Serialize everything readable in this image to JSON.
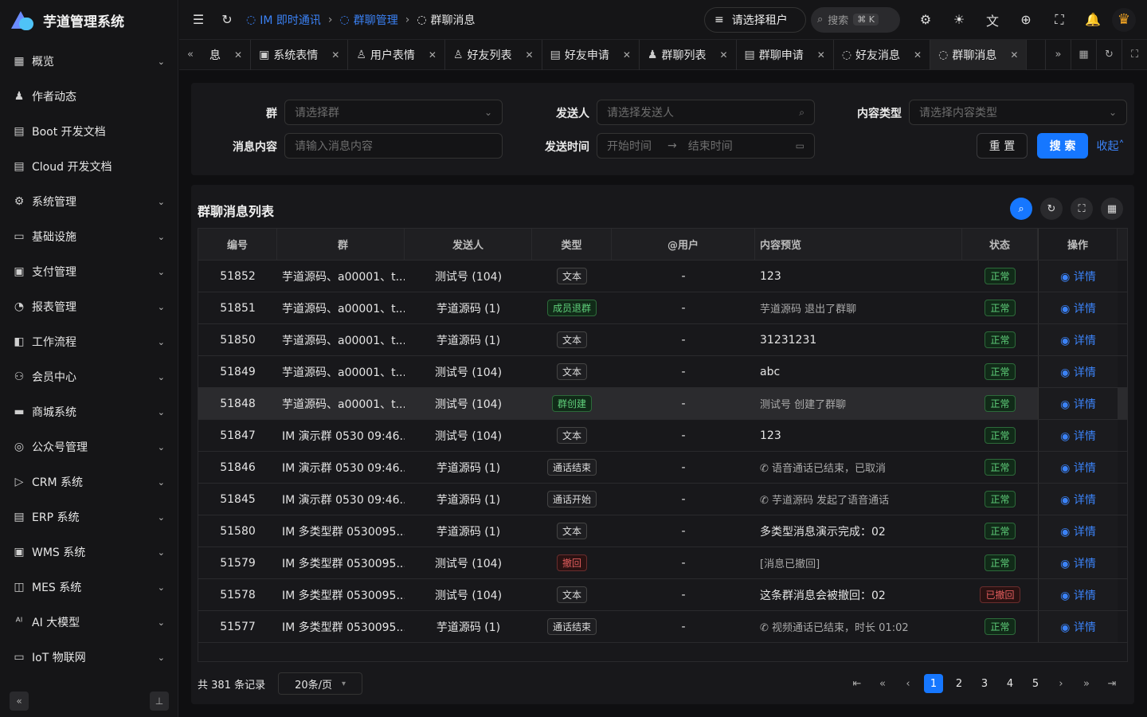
{
  "app": {
    "title": "芋道管理系统"
  },
  "sidebar": {
    "items": [
      {
        "label": "概览",
        "icon": "grid-icon",
        "chevron": true
      },
      {
        "label": "作者动态",
        "icon": "user-icon",
        "chevron": false
      },
      {
        "label": "Boot 开发文档",
        "icon": "doc-icon",
        "chevron": false
      },
      {
        "label": "Cloud 开发文档",
        "icon": "doc-icon",
        "chevron": false
      },
      {
        "label": "系统管理",
        "icon": "gear-icon",
        "chevron": true
      },
      {
        "label": "基础设施",
        "icon": "monitor-icon",
        "chevron": true
      },
      {
        "label": "支付管理",
        "icon": "pay-icon",
        "chevron": true
      },
      {
        "label": "报表管理",
        "icon": "chart-icon",
        "chevron": true
      },
      {
        "label": "工作流程",
        "icon": "flow-icon",
        "chevron": true
      },
      {
        "label": "会员中心",
        "icon": "members-icon",
        "chevron": true
      },
      {
        "label": "商城系统",
        "icon": "shop-icon",
        "chevron": true
      },
      {
        "label": "公众号管理",
        "icon": "compass-icon",
        "chevron": true
      },
      {
        "label": "CRM 系统",
        "icon": "crm-icon",
        "chevron": true
      },
      {
        "label": "ERP 系统",
        "icon": "erp-icon",
        "chevron": true
      },
      {
        "label": "WMS 系统",
        "icon": "box-icon",
        "chevron": true
      },
      {
        "label": "MES 系统",
        "icon": "chip-icon",
        "chevron": true
      },
      {
        "label": "AI 大模型",
        "icon": "ai-icon",
        "chevron": true
      },
      {
        "label": "IoT 物联网",
        "icon": "iot-icon",
        "chevron": true
      }
    ]
  },
  "header": {
    "breadcrumb": [
      {
        "label": "IM 即时通讯",
        "link": true
      },
      {
        "label": "群聊管理",
        "link": true
      },
      {
        "label": "群聊消息",
        "link": false
      }
    ],
    "tenant_placeholder": "请选择租户",
    "search_label": "搜索",
    "search_shortcut": "⌘ K"
  },
  "tabs": [
    {
      "label": "息",
      "icon": ""
    },
    {
      "label": "系统表情",
      "icon": "▣"
    },
    {
      "label": "用户表情",
      "icon": "♙"
    },
    {
      "label": "好友列表",
      "icon": "♙"
    },
    {
      "label": "好友申请",
      "icon": "▤"
    },
    {
      "label": "群聊列表",
      "icon": "♟"
    },
    {
      "label": "群聊申请",
      "icon": "▤"
    },
    {
      "label": "好友消息",
      "icon": "◌"
    },
    {
      "label": "群聊消息",
      "icon": "◌",
      "active": true
    }
  ],
  "filter": {
    "group_label": "群",
    "group_placeholder": "请选择群",
    "sender_label": "发送人",
    "sender_placeholder": "请选择发送人",
    "content_type_label": "内容类型",
    "content_type_placeholder": "请选择内容类型",
    "content_label": "消息内容",
    "content_placeholder": "请输入消息内容",
    "time_label": "发送时间",
    "time_start_placeholder": "开始时间",
    "time_end_placeholder": "结束时间",
    "reset": "重 置",
    "search": "搜 索",
    "collapse": "收起"
  },
  "table": {
    "title": "群聊消息列表",
    "columns": [
      "编号",
      "群",
      "发送人",
      "类型",
      "@用户",
      "内容预览",
      "状态",
      "操作"
    ],
    "rows": [
      {
        "id": "51852",
        "group": "芋道源码、a00001、t...",
        "sender": "测试号 (104)",
        "type": "文本",
        "type_style": "",
        "at": "-",
        "content": "123",
        "content_style": "",
        "status": "正常",
        "status_style": "green",
        "op": "详情"
      },
      {
        "id": "51851",
        "group": "芋道源码、a00001、t...",
        "sender": "芋道源码 (1)",
        "type": "成员退群",
        "type_style": "green",
        "at": "-",
        "content": "芋道源码 退出了群聊",
        "content_style": "muted",
        "status": "正常",
        "status_style": "green",
        "op": "详情"
      },
      {
        "id": "51850",
        "group": "芋道源码、a00001、t...",
        "sender": "芋道源码 (1)",
        "type": "文本",
        "type_style": "",
        "at": "-",
        "content": "31231231",
        "content_style": "",
        "status": "正常",
        "status_style": "green",
        "op": "详情"
      },
      {
        "id": "51849",
        "group": "芋道源码、a00001、t...",
        "sender": "测试号 (104)",
        "type": "文本",
        "type_style": "",
        "at": "-",
        "content": "abc",
        "content_style": "",
        "status": "正常",
        "status_style": "green",
        "op": "详情"
      },
      {
        "id": "51848",
        "group": "芋道源码、a00001、t...",
        "sender": "测试号 (104)",
        "type": "群创建",
        "type_style": "green",
        "at": "-",
        "content": "测试号 创建了群聊",
        "content_style": "muted",
        "status": "正常",
        "status_style": "green",
        "op": "详情",
        "highlight": true
      },
      {
        "id": "51847",
        "group": "IM 演示群 0530 09:46...",
        "sender": "测试号 (104)",
        "type": "文本",
        "type_style": "",
        "at": "-",
        "content": "123",
        "content_style": "",
        "status": "正常",
        "status_style": "green",
        "op": "详情"
      },
      {
        "id": "51846",
        "group": "IM 演示群 0530 09:46...",
        "sender": "芋道源码 (1)",
        "type": "通话结束",
        "type_style": "",
        "at": "-",
        "content": "✆ 语音通话已结束，已取消",
        "content_style": "muted",
        "status": "正常",
        "status_style": "green",
        "op": "详情"
      },
      {
        "id": "51845",
        "group": "IM 演示群 0530 09:46...",
        "sender": "芋道源码 (1)",
        "type": "通话开始",
        "type_style": "",
        "at": "-",
        "content": "✆ 芋道源码 发起了语音通话",
        "content_style": "muted",
        "status": "正常",
        "status_style": "green",
        "op": "详情"
      },
      {
        "id": "51580",
        "group": "IM 多类型群 0530095...",
        "sender": "芋道源码 (1)",
        "type": "文本",
        "type_style": "",
        "at": "-",
        "content": "多类型消息演示完成：02",
        "content_style": "",
        "status": "正常",
        "status_style": "green",
        "op": "详情"
      },
      {
        "id": "51579",
        "group": "IM 多类型群 0530095...",
        "sender": "测试号 (104)",
        "type": "撤回",
        "type_style": "red",
        "at": "-",
        "content": "[消息已撤回]",
        "content_style": "muted",
        "status": "正常",
        "status_style": "green",
        "op": "详情"
      },
      {
        "id": "51578",
        "group": "IM 多类型群 0530095...",
        "sender": "测试号 (104)",
        "type": "文本",
        "type_style": "",
        "at": "-",
        "content": "这条群消息会被撤回：02",
        "content_style": "",
        "status": "已撤回",
        "status_style": "red",
        "op": "详情"
      },
      {
        "id": "51577",
        "group": "IM 多类型群 0530095...",
        "sender": "芋道源码 (1)",
        "type": "通话结束",
        "type_style": "",
        "at": "-",
        "content": "✆ 视频通话已结束，时长 01:02",
        "content_style": "muted",
        "status": "正常",
        "status_style": "green",
        "op": "详情"
      }
    ]
  },
  "pagination": {
    "total": "共 381 条记录",
    "page_size": "20条/页",
    "pages": [
      "1",
      "2",
      "3",
      "4",
      "5"
    ],
    "current": "1"
  },
  "colors": {
    "accent": "#1677ff",
    "success": "#5fcf7a",
    "danger": "#e35d5d"
  }
}
